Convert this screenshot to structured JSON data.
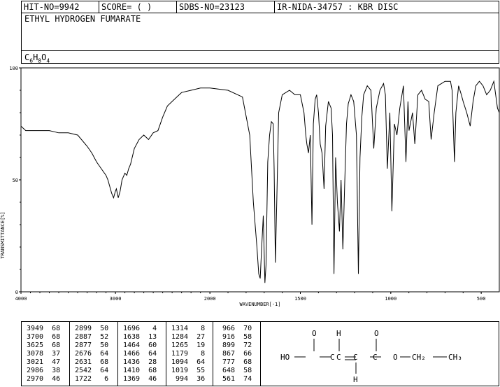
{
  "header": {
    "hit": "HIT-NO=9942",
    "score": "SCORE=  (   )",
    "sdbs": "SDBS-NO=23123",
    "ir": "IR-NIDA-34757 : KBR DISC",
    "compound": "ETHYL HYDROGEN FUMARATE",
    "formula": {
      "c": "C",
      "c_n": "6",
      "h": "H",
      "h_n": "8",
      "o": "O",
      "o_n": "4"
    }
  },
  "chart_data": {
    "type": "line",
    "xlabel": "WAVENUMBER[-1]",
    "ylabel": "TRANSMITTANCE[%]",
    "xlim": [
      4000,
      400
    ],
    "ylim": [
      0,
      100
    ],
    "x_ticks": [
      "4000",
      "3000",
      "2000",
      "1500",
      "1000",
      "500"
    ],
    "y_ticks": [
      "100",
      "50",
      "0"
    ],
    "series": [
      {
        "x": [
          4000,
          3950,
          3900,
          3800,
          3700,
          3600,
          3500,
          3400,
          3300,
          3250,
          3200,
          3150,
          3100,
          3080,
          3060,
          3040,
          3020,
          3000,
          2990,
          2970,
          2950,
          2930,
          2900,
          2880,
          2860,
          2840,
          2800,
          2750,
          2700,
          2650,
          2600,
          2550,
          2500,
          2450,
          2400,
          2300,
          2200,
          2100,
          2000,
          1900,
          1820,
          1780,
          1760,
          1740,
          1730,
          1722,
          1715,
          1705,
          1696,
          1690,
          1680,
          1670,
          1660,
          1650,
          1645,
          1638,
          1630,
          1620,
          1600,
          1560,
          1530,
          1500,
          1480,
          1470,
          1464,
          1455,
          1445,
          1436,
          1428,
          1418,
          1410,
          1400,
          1390,
          1380,
          1369,
          1360,
          1345,
          1330,
          1322,
          1314,
          1305,
          1295,
          1284,
          1275,
          1265,
          1255,
          1245,
          1235,
          1220,
          1205,
          1190,
          1179,
          1170,
          1160,
          1150,
          1130,
          1110,
          1094,
          1080,
          1060,
          1040,
          1030,
          1019,
          1005,
          994,
          980,
          966,
          950,
          930,
          916,
          905,
          899,
          880,
          867,
          850,
          830,
          810,
          790,
          777,
          760,
          740,
          720,
          700,
          680,
          670,
          661,
          648,
          640,
          625,
          610,
          600,
          580,
          561,
          545,
          530,
          510,
          490,
          470,
          450,
          430,
          410,
          400
        ],
        "y": [
          74,
          72,
          72,
          72,
          72,
          71,
          71,
          70,
          65,
          62,
          58,
          55,
          52,
          50,
          47,
          44,
          42,
          45,
          46,
          42,
          45,
          50,
          53,
          52,
          55,
          57,
          64,
          68,
          70,
          68,
          71,
          72,
          78,
          83,
          85,
          89,
          90,
          91,
          91,
          90,
          87,
          70,
          40,
          20,
          8,
          6,
          18,
          34,
          4,
          12,
          58,
          70,
          76,
          75,
          55,
          13,
          42,
          80,
          88,
          90,
          88,
          88,
          80,
          70,
          66,
          62,
          70,
          30,
          75,
          86,
          88,
          80,
          66,
          62,
          46,
          74,
          85,
          82,
          70,
          8,
          60,
          40,
          27,
          50,
          19,
          48,
          75,
          84,
          88,
          85,
          70,
          8,
          60,
          78,
          88,
          92,
          90,
          64,
          82,
          90,
          93,
          88,
          55,
          80,
          36,
          75,
          70,
          82,
          92,
          58,
          85,
          72,
          80,
          66,
          88,
          90,
          86,
          85,
          68,
          80,
          92,
          93,
          94,
          94,
          94,
          90,
          58,
          80,
          92,
          88,
          85,
          80,
          74,
          85,
          92,
          94,
          92,
          88,
          90,
          94,
          82,
          80
        ]
      }
    ]
  },
  "peak_table": {
    "columns": [
      [
        "3949  68",
        "3700  68",
        "3625  68",
        "3078  37",
        "3021  47",
        "2986  38",
        "2970  46"
      ],
      [
        "2899  50",
        "2887  52",
        "2877  50",
        "2676  64",
        "2631  68",
        "2542  64",
        "1722   6"
      ],
      [
        "1696   4",
        "1638  13",
        "1464  60",
        "1466  64",
        "1436  28",
        "1410  68",
        "1369  46"
      ],
      [
        "1314   8",
        "1284  27",
        "1265  19",
        "1179   8",
        "1094  64",
        "1019  55",
        " 994  36"
      ],
      [
        " 966  70",
        " 916  58",
        " 899  72",
        " 867  66",
        " 777  68",
        " 648  58",
        " 561  74"
      ]
    ]
  },
  "structure": {
    "o1": "O",
    "h1": "H",
    "o2": "O",
    "ho": "HO",
    "o_link": "O",
    "ch2": "CH₂",
    "ch3": "CH₃",
    "h2": "H"
  }
}
